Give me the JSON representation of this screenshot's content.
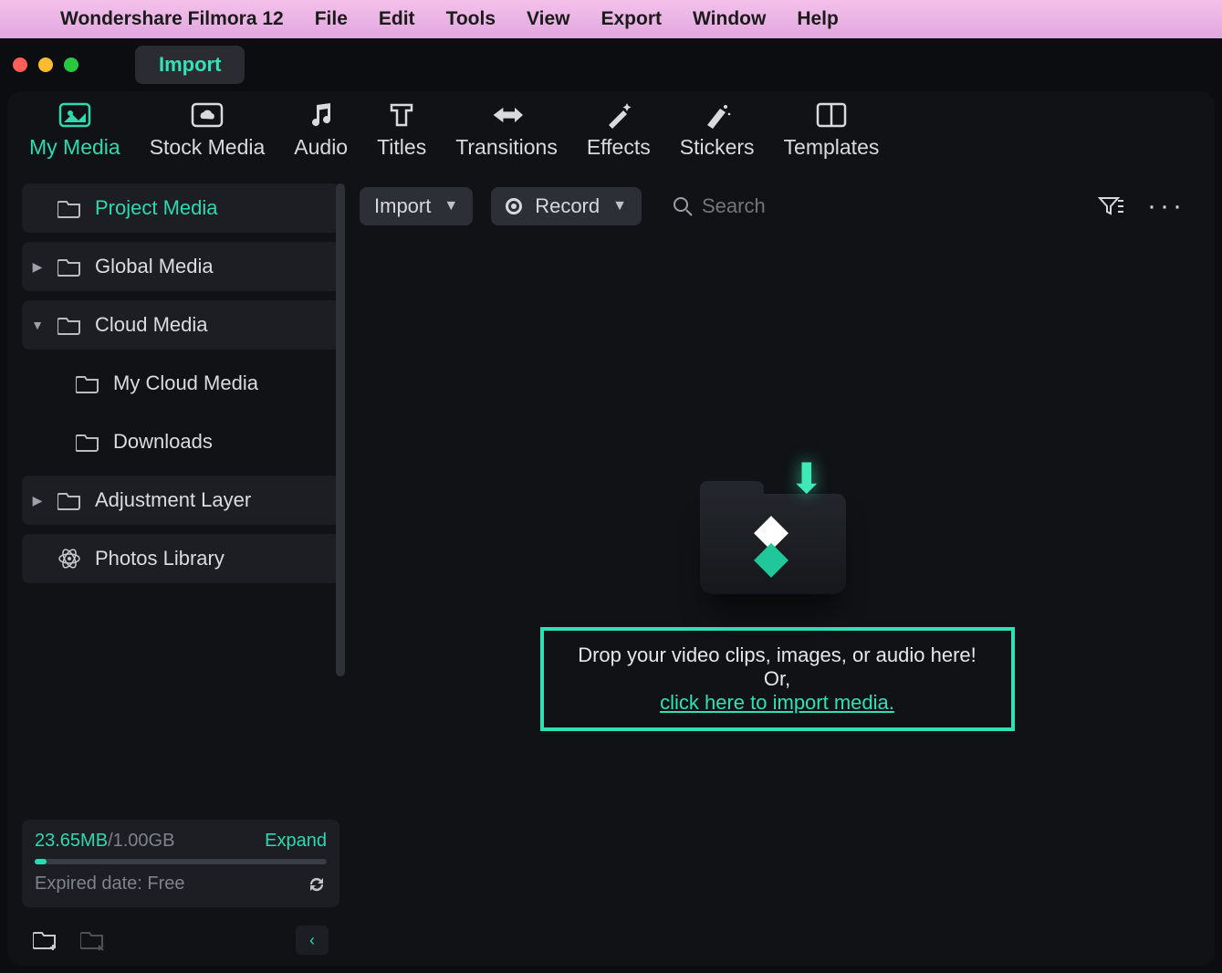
{
  "menubar": {
    "app_name": "Wondershare Filmora 12",
    "items": [
      "File",
      "Edit",
      "Tools",
      "View",
      "Export",
      "Window",
      "Help"
    ]
  },
  "titlebar": {
    "import_chip": "Import"
  },
  "primary_tabs": [
    {
      "label": "My Media",
      "icon": "media-icon",
      "active": true
    },
    {
      "label": "Stock Media",
      "icon": "cloud-icon",
      "active": false
    },
    {
      "label": "Audio",
      "icon": "music-icon",
      "active": false
    },
    {
      "label": "Titles",
      "icon": "text-icon",
      "active": false
    },
    {
      "label": "Transitions",
      "icon": "transition-icon",
      "active": false
    },
    {
      "label": "Effects",
      "icon": "wand-icon",
      "active": false
    },
    {
      "label": "Stickers",
      "icon": "sticker-icon",
      "active": false
    },
    {
      "label": "Templates",
      "icon": "template-icon",
      "active": false
    }
  ],
  "sidebar": {
    "items": [
      {
        "label": "Project Media",
        "active": true,
        "expandable": false
      },
      {
        "label": "Global Media",
        "active": false,
        "expandable": true,
        "expanded": false
      },
      {
        "label": "Cloud Media",
        "active": false,
        "expandable": true,
        "expanded": true
      },
      {
        "label": "My Cloud Media",
        "active": false,
        "sub": true
      },
      {
        "label": "Downloads",
        "active": false,
        "sub": true
      },
      {
        "label": "Adjustment Layer",
        "active": false,
        "expandable": true,
        "expanded": false
      },
      {
        "label": "Photos Library",
        "active": false,
        "icon": "atom-icon"
      }
    ],
    "storage": {
      "used": "23.65MB",
      "total": "1.00GB",
      "expand": "Expand",
      "expired": "Expired date: Free"
    }
  },
  "toolbar": {
    "import_label": "Import",
    "record_label": "Record",
    "search_placeholder": "Search"
  },
  "drop": {
    "line1": "Drop your video clips, images, or audio here! Or,",
    "link": "click here to import media."
  }
}
